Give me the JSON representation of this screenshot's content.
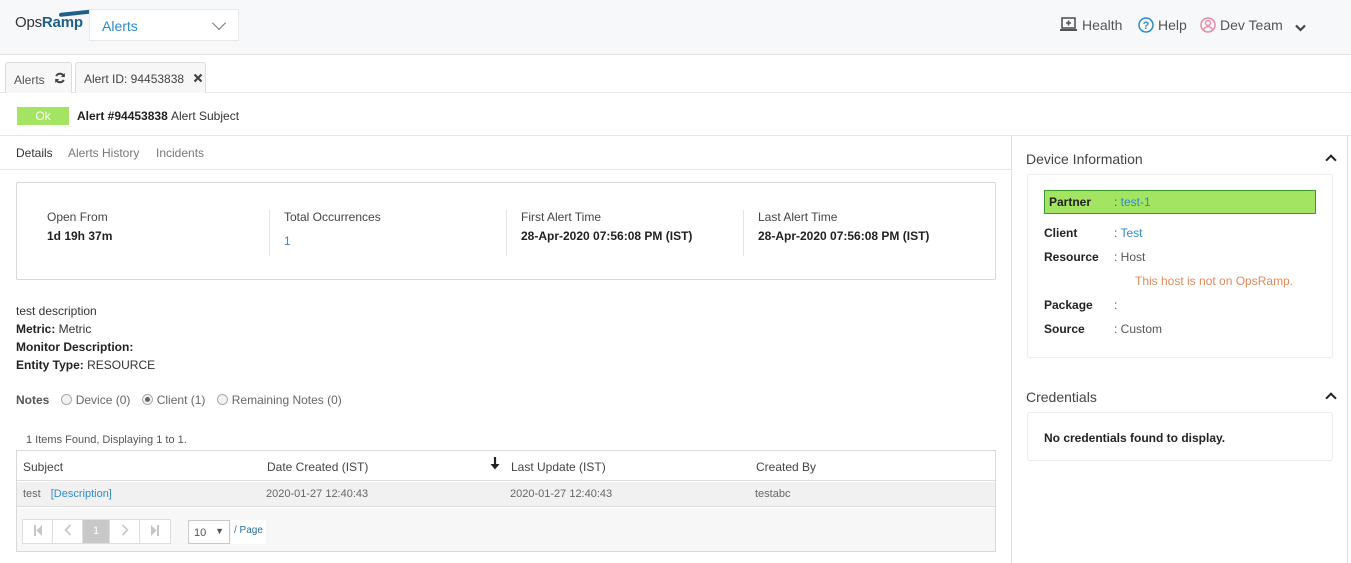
{
  "header": {
    "logo_prefix": "Ops",
    "logo_suffix": "Ramp",
    "module_select": {
      "selected": "Alerts"
    },
    "health_label": "Health",
    "help_label": "Help",
    "user_label": "Dev Team"
  },
  "tabs": [
    {
      "label": "Alerts",
      "icon": "refresh-icon"
    },
    {
      "label": "Alert ID: 94453838",
      "icon": "close-icon"
    }
  ],
  "alert": {
    "status": "Ok",
    "status_color": "#a3e462",
    "number": "Alert #94453838",
    "subject": "Alert Subject"
  },
  "subtabs": [
    "Details",
    "Alerts History",
    "Incidents"
  ],
  "summary": [
    {
      "label": "Open From",
      "value": "1d 19h 37m"
    },
    {
      "label": "Total Occurrences",
      "value": "1"
    },
    {
      "label": "First Alert Time",
      "value": "28-Apr-2020 07:56:08 PM (IST)"
    },
    {
      "label": "Last Alert Time",
      "value": "28-Apr-2020 07:56:08 PM (IST)"
    }
  ],
  "description": {
    "text": "test description",
    "metric_label": "Metric:",
    "metric_value": " Metric",
    "monitor_label": "Monitor Description:",
    "monitor_value": "",
    "entity_label": "Entity Type:",
    "entity_value": " RESOURCE"
  },
  "notes": {
    "label": "Notes",
    "options": [
      {
        "label": "Device (0)",
        "checked": false
      },
      {
        "label": "Client (1)",
        "checked": true
      },
      {
        "label": "Remaining Notes (0)",
        "checked": false
      }
    ]
  },
  "table": {
    "items_found": "1  Items Found, Displaying  1  to  1.",
    "columns": [
      "Subject",
      "Date Created (IST)",
      "Last Update (IST)",
      "Created By"
    ],
    "rows": [
      {
        "subject": "test",
        "link": "[Description]",
        "date_created": "2020-01-27 12:40:43",
        "last_update": "2020-01-27 12:40:43",
        "created_by": "testabc"
      }
    ],
    "pager": {
      "current_page": "1",
      "page_size": "10",
      "per_page_label": "/ Page"
    }
  },
  "device_info": {
    "title": "Device Information",
    "rows": [
      {
        "key": "Partner",
        "value": "test-1",
        "link": true,
        "highlight": true
      },
      {
        "key": "Client",
        "value": "Test",
        "link": true
      },
      {
        "key": "Resource",
        "value": "Host"
      },
      {
        "key": "Package",
        "value": ""
      },
      {
        "key": "Source",
        "value": "Custom"
      }
    ],
    "warning": "This host is not on OpsRamp.",
    "warning_color": "#e0895a",
    "highlight_color": "#a3e462"
  },
  "credentials": {
    "title": "Credentials",
    "empty_text": "No credentials found to display."
  }
}
